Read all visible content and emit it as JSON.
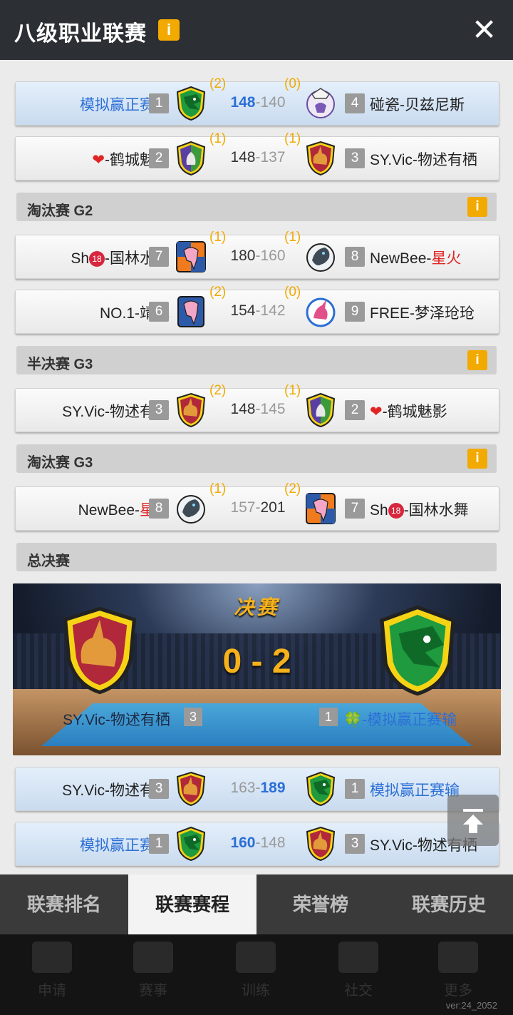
{
  "header": {
    "title": "八级职业联赛",
    "info": "i",
    "close": "✕"
  },
  "matches_top": [
    {
      "left_name": "模拟赢正赛输",
      "left_rank": "1",
      "left_wins": "(2)",
      "score_left": "148",
      "score_right": "140",
      "right_wins": "(0)",
      "right_rank": "4",
      "right_name": "碰瓷-贝兹尼斯"
    },
    {
      "left_heart": "❤",
      "left_name": "-鹤城魅影",
      "left_rank": "2",
      "left_wins": "(1)",
      "score_left": "148",
      "score_right": "137",
      "right_wins": "(1)",
      "right_rank": "3",
      "right_name": "SY.Vic-物述有栖"
    }
  ],
  "sections": {
    "s1": "淘汰赛 G2",
    "s2": "半决赛 G3",
    "s3": "淘汰赛 G3",
    "s4": "总决赛",
    "info": "i"
  },
  "matches_g2": [
    {
      "left_a": "Sh",
      "left_badge": "18",
      "left_b": "-国林水舞",
      "left_rank": "7",
      "left_wins": "(1)",
      "score_left": "180",
      "score_right": "160",
      "right_wins": "(1)",
      "right_rank": "8",
      "right_a": "NewBee-",
      "right_b": "星火"
    },
    {
      "left_name": "NO.1-靖威",
      "left_rank": "6",
      "left_wins": "(2)",
      "score_left": "154",
      "score_right": "142",
      "right_wins": "(0)",
      "right_rank": "9",
      "right_name": "FREE-梦泽玱玱"
    }
  ],
  "match_semi": {
    "left_name": "SY.Vic-物述有栖",
    "left_rank": "3",
    "left_wins": "(2)",
    "score_left": "148",
    "score_right": "145",
    "right_wins": "(1)",
    "right_rank": "2",
    "right_heart": "❤",
    "right_name": "-鹤城魅影"
  },
  "match_g3": {
    "left_a": "NewBee-",
    "left_b": "星火",
    "left_rank": "8",
    "left_wins": "(1)",
    "score_left": "157",
    "score_right": "201",
    "right_wins": "(2)",
    "right_rank": "7",
    "right_a": "Sh",
    "right_badge": "18",
    "right_b": "-国林水舞"
  },
  "final": {
    "title": "决赛",
    "score": "0 - 2",
    "left_name": "SY.Vic-物述有栖",
    "left_rank": "3",
    "right_rank": "1",
    "right_clover": "🍀",
    "right_name": "-模拟赢正赛输"
  },
  "final_games": [
    {
      "left_name": "SY.Vic-物述有栖",
      "left_rank": "3",
      "score_left": "163",
      "score_right": "189",
      "right_rank": "1",
      "right_name": "模拟赢正赛输"
    },
    {
      "left_name": "模拟赢正赛输",
      "left_rank": "1",
      "score_left": "160",
      "score_right": "148",
      "right_rank": "3",
      "right_name": "SY.Vic-物述有栖"
    }
  ],
  "tabs": [
    "联赛排名",
    "联赛赛程",
    "荣誉榜",
    "联赛历史"
  ],
  "bottom_nav": [
    "申请",
    "赛事",
    "训练",
    "社交",
    "更多"
  ],
  "version": "ver:24_2052",
  "colors": {
    "accent_gold": "#f2a900",
    "win_blue": "#2b6fd6",
    "highlight_row": "#d6e6f7"
  },
  "icons": {
    "scroll_top": "arrow-up-to-line-icon"
  }
}
